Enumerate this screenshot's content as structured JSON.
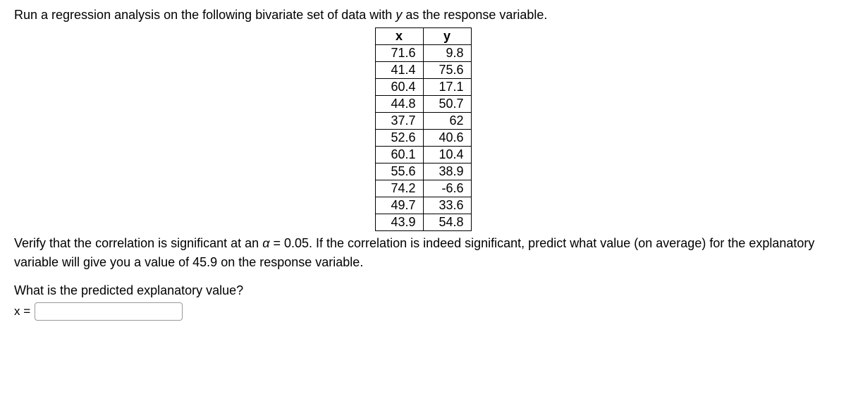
{
  "intro_part1": "Run a regression analysis on the following bivariate set of data with ",
  "intro_var": "y",
  "intro_part2": " as the response variable.",
  "table": {
    "headers": [
      "x",
      "y"
    ],
    "rows": [
      [
        "71.6",
        "9.8"
      ],
      [
        "41.4",
        "75.6"
      ],
      [
        "60.4",
        "17.1"
      ],
      [
        "44.8",
        "50.7"
      ],
      [
        "37.7",
        "62"
      ],
      [
        "52.6",
        "40.6"
      ],
      [
        "60.1",
        "10.4"
      ],
      [
        "55.6",
        "38.9"
      ],
      [
        "74.2",
        "-6.6"
      ],
      [
        "49.7",
        "33.6"
      ],
      [
        "43.9",
        "54.8"
      ]
    ]
  },
  "followup_part1": "Verify that the correlation is significant at an ",
  "followup_alpha": "α",
  "followup_eq": " = ",
  "followup_val": "0.05",
  "followup_part2": ". If the correlation is indeed significant, predict what value (on average) for the explanatory variable will give you a value of ",
  "followup_target": "45.9",
  "followup_part3": " on the response variable.",
  "question": "What is the predicted explanatory value?",
  "answer_label": "x = "
}
